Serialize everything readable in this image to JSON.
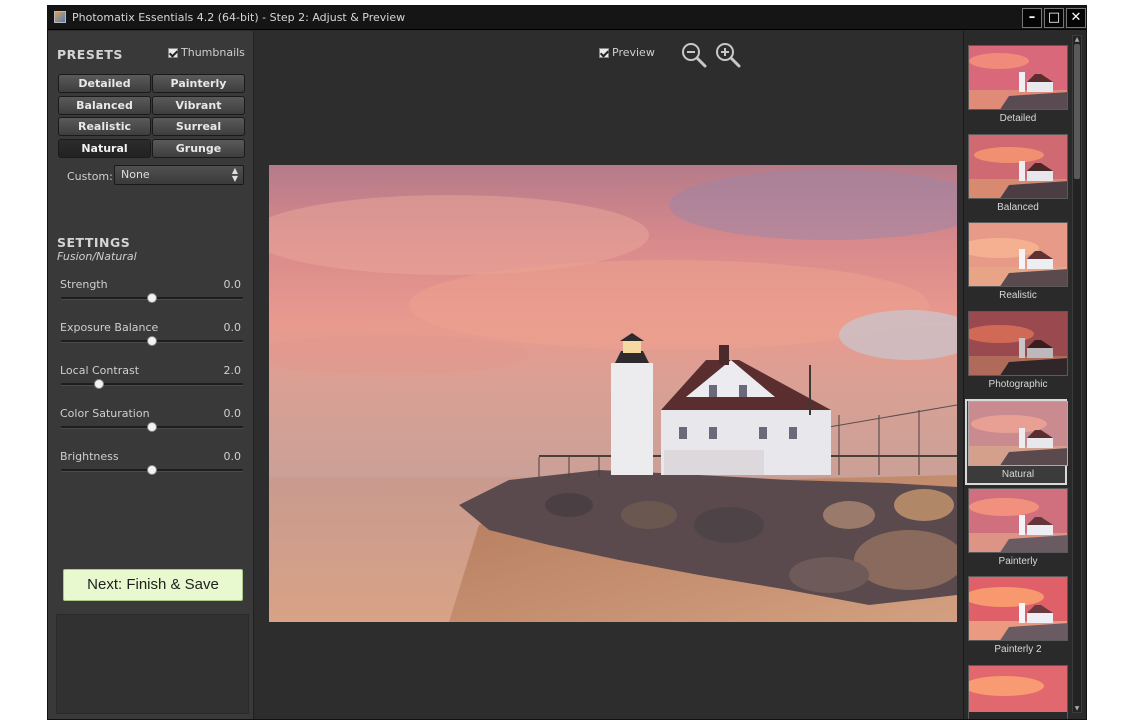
{
  "window": {
    "title": "Photomatix Essentials 4.2 (64-bit) - Step 2: Adjust & Preview",
    "min_label": "–",
    "max_label": "□",
    "close_label": "✕"
  },
  "presets": {
    "title": "PRESETS",
    "thumbnails_label": "Thumbnails",
    "thumbnails_checked": true,
    "buttons": [
      {
        "label": "Detailed",
        "active": false
      },
      {
        "label": "Painterly",
        "active": false
      },
      {
        "label": "Balanced",
        "active": false
      },
      {
        "label": "Vibrant",
        "active": false
      },
      {
        "label": "Realistic",
        "active": false
      },
      {
        "label": "Surreal",
        "active": false
      },
      {
        "label": "Natural",
        "active": true
      },
      {
        "label": "Grunge",
        "active": false
      }
    ],
    "custom_label": "Custom:",
    "custom_value": "None"
  },
  "settings": {
    "title": "SETTINGS",
    "subtitle": "Fusion/Natural",
    "sliders": [
      {
        "label": "Strength",
        "value": "0.0",
        "position": 0.5
      },
      {
        "label": "Exposure Balance",
        "value": "0.0",
        "position": 0.5
      },
      {
        "label": "Local Contrast",
        "value": "2.0",
        "position": 0.21
      },
      {
        "label": "Color Saturation",
        "value": "0.0",
        "position": 0.5
      },
      {
        "label": "Brightness",
        "value": "0.0",
        "position": 0.5
      }
    ]
  },
  "next_button": {
    "label": "Next: Finish & Save"
  },
  "preview": {
    "label": "Preview",
    "checked": true,
    "zoom_out_icon": "zoom-out-icon",
    "zoom_in_icon": "zoom-in-icon"
  },
  "thumbnails": {
    "items": [
      {
        "label": "Detailed",
        "selected": false
      },
      {
        "label": "Balanced",
        "selected": false
      },
      {
        "label": "Realistic",
        "selected": false
      },
      {
        "label": "Photographic",
        "selected": false
      },
      {
        "label": "Natural",
        "selected": true
      },
      {
        "label": "Painterly",
        "selected": false
      },
      {
        "label": "Painterly 2",
        "selected": false
      },
      {
        "label": "",
        "selected": false
      }
    ]
  },
  "colors": {
    "window_bg": "#2b2b2b",
    "panel_bg": "#393939",
    "accent_button": "#e8f8cf",
    "text": "#cfcfcf"
  }
}
